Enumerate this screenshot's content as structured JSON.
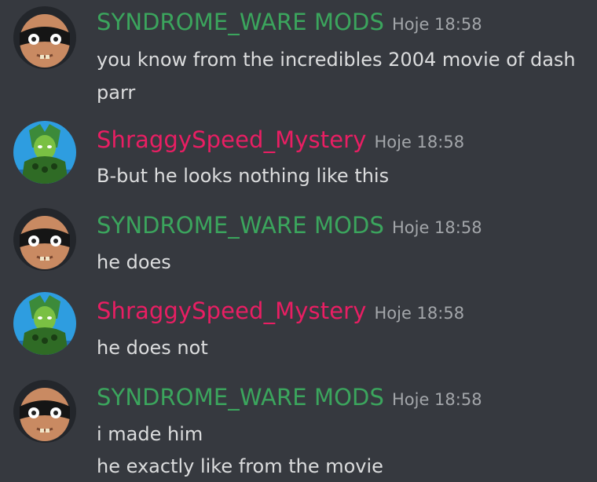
{
  "colors": {
    "background": "#36393f",
    "message_text": "#dcddde",
    "timestamp": "#a3a6aa",
    "syndrome_name": "#3ba55d",
    "shraggy_name": "#e91e63"
  },
  "users": {
    "syndrome": {
      "name": "SYNDROME_WARE MODS",
      "avatar_icon": "masked-face-avatar-icon"
    },
    "shraggy": {
      "name": "ShraggySpeed_Mystery",
      "avatar_icon": "green-character-avatar-icon"
    }
  },
  "messages": [
    {
      "author": "SYNDROME_WARE MODS",
      "time": "Hoje 18:58",
      "lines": [
        "you know from the incredibles 2004 movie of dash",
        "parr"
      ]
    },
    {
      "author": "ShraggySpeed_Mystery",
      "time": "Hoje 18:58",
      "lines": [
        "B-but he looks nothing like this"
      ]
    },
    {
      "author": "SYNDROME_WARE MODS",
      "time": "Hoje 18:58",
      "lines": [
        "he does"
      ]
    },
    {
      "author": "ShraggySpeed_Mystery",
      "time": "Hoje 18:58",
      "lines": [
        "he does not"
      ]
    },
    {
      "author": "SYNDROME_WARE MODS",
      "time": "Hoje 18:58",
      "lines": [
        "i made him",
        "he exactly like from the movie"
      ]
    }
  ]
}
